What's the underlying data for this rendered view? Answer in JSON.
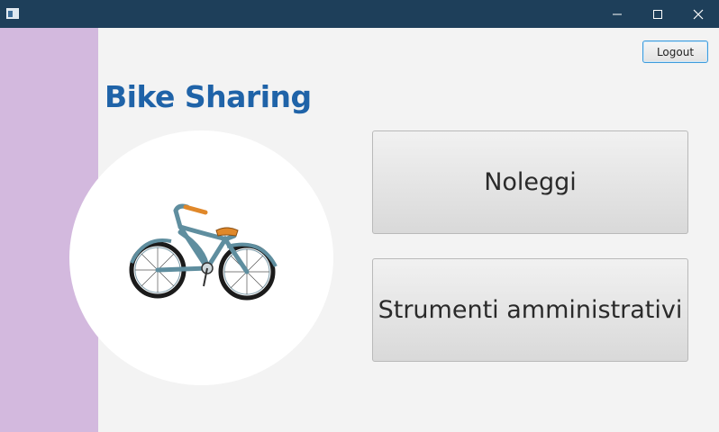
{
  "app": {
    "title": "Bike Sharing"
  },
  "window": {
    "minimize_icon": "minimize-icon",
    "maximize_icon": "maximize-icon",
    "close_icon": "close-icon"
  },
  "header": {
    "logout_label": "Logout"
  },
  "main": {
    "noleggi_label": "Noleggi",
    "admin_label": "Strumenti amministrativi"
  },
  "colors": {
    "titlebar": "#1e3f5a",
    "sidebar": "#d3b9de",
    "title": "#1f63a8",
    "logout_border": "#3d9bdc"
  },
  "illustration": {
    "icon": "bicycle-icon"
  }
}
